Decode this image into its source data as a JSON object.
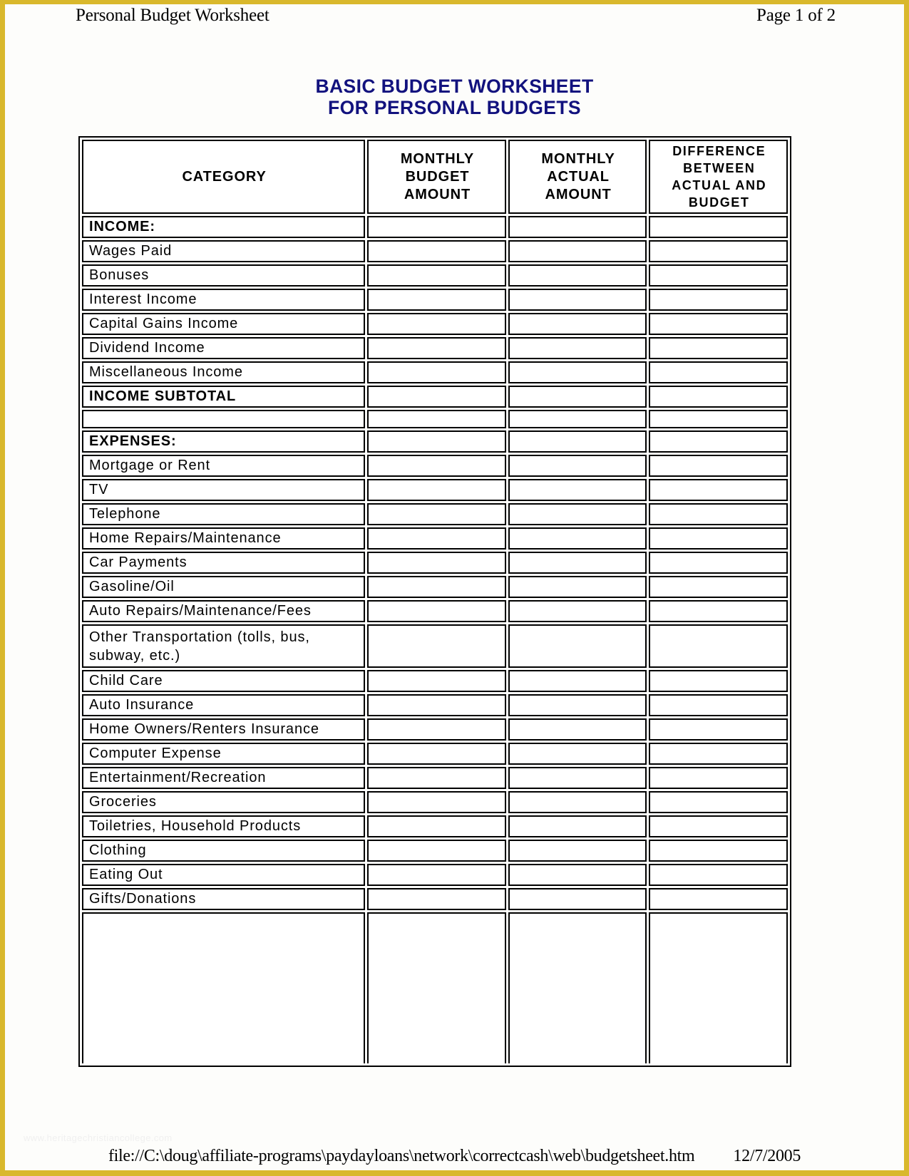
{
  "page": {
    "running_header_left": "Personal Budget Worksheet",
    "running_header_right": "Page 1 of 2",
    "title_line1": "BASIC BUDGET WORKSHEET",
    "title_line2": "FOR PERSONAL BUDGETS",
    "watermark": "www.heritagechristiancollege.com",
    "footer_path": "file://C:\\doug\\affiliate-programs\\paydayloans\\network\\correctcash\\web\\budgetsheet.htm",
    "footer_date": "12/7/2005",
    "border_color": "#d9b82c",
    "accent_color": "#12127e"
  },
  "table": {
    "columns": [
      {
        "key": "category",
        "label": "CATEGORY"
      },
      {
        "key": "monthly_budget",
        "label": "MONTHLY BUDGET AMOUNT"
      },
      {
        "key": "monthly_actual",
        "label": "MONTHLY ACTUAL AMOUNT"
      },
      {
        "key": "difference",
        "label": "DIFFERENCE BETWEEN ACTUAL AND BUDGET"
      }
    ],
    "column_label_lines": {
      "category": [
        "CATEGORY"
      ],
      "monthly_budget": [
        "MONTHLY",
        "BUDGET",
        "AMOUNT"
      ],
      "monthly_actual": [
        "MONTHLY",
        "ACTUAL",
        "AMOUNT"
      ],
      "difference": [
        "DIFFERENCE",
        "BETWEEN",
        "ACTUAL AND",
        "BUDGET"
      ]
    },
    "rows": [
      {
        "label": "INCOME:",
        "type": "section",
        "budget": "",
        "actual": "",
        "difference": ""
      },
      {
        "label": "Wages Paid",
        "type": "item",
        "budget": "",
        "actual": "",
        "difference": ""
      },
      {
        "label": "Bonuses",
        "type": "item",
        "budget": "",
        "actual": "",
        "difference": ""
      },
      {
        "label": "Interest Income",
        "type": "item",
        "budget": "",
        "actual": "",
        "difference": ""
      },
      {
        "label": "Capital Gains Income",
        "type": "item",
        "budget": "",
        "actual": "",
        "difference": ""
      },
      {
        "label": "Dividend Income",
        "type": "item",
        "budget": "",
        "actual": "",
        "difference": ""
      },
      {
        "label": "Miscellaneous Income",
        "type": "item",
        "budget": "",
        "actual": "",
        "difference": ""
      },
      {
        "label": "INCOME SUBTOTAL",
        "type": "section",
        "budget": "",
        "actual": "",
        "difference": ""
      },
      {
        "label": "",
        "type": "spacer",
        "budget": "",
        "actual": "",
        "difference": ""
      },
      {
        "label": "EXPENSES:",
        "type": "section",
        "budget": "",
        "actual": "",
        "difference": ""
      },
      {
        "label": "Mortgage or Rent",
        "type": "item",
        "budget": "",
        "actual": "",
        "difference": ""
      },
      {
        "label": "TV",
        "type": "item",
        "budget": "",
        "actual": "",
        "difference": ""
      },
      {
        "label": "Telephone",
        "type": "item",
        "budget": "",
        "actual": "",
        "difference": ""
      },
      {
        "label": "Home Repairs/Maintenance",
        "type": "item",
        "budget": "",
        "actual": "",
        "difference": ""
      },
      {
        "label": "Car Payments",
        "type": "item",
        "budget": "",
        "actual": "",
        "difference": ""
      },
      {
        "label": "Gasoline/Oil",
        "type": "item",
        "budget": "",
        "actual": "",
        "difference": ""
      },
      {
        "label": "Auto Repairs/Maintenance/Fees",
        "type": "item",
        "budget": "",
        "actual": "",
        "difference": ""
      },
      {
        "label": "Other Transportation (tolls, bus, subway, etc.)",
        "type": "tall",
        "budget": "",
        "actual": "",
        "difference": ""
      },
      {
        "label": "Child Care",
        "type": "item",
        "budget": "",
        "actual": "",
        "difference": ""
      },
      {
        "label": "Auto Insurance",
        "type": "item",
        "budget": "",
        "actual": "",
        "difference": ""
      },
      {
        "label": "Home Owners/Renters Insurance",
        "type": "item",
        "budget": "",
        "actual": "",
        "difference": ""
      },
      {
        "label": "Computer Expense",
        "type": "item",
        "budget": "",
        "actual": "",
        "difference": ""
      },
      {
        "label": "Entertainment/Recreation",
        "type": "item",
        "budget": "",
        "actual": "",
        "difference": ""
      },
      {
        "label": "Groceries",
        "type": "item",
        "budget": "",
        "actual": "",
        "difference": ""
      },
      {
        "label": "Toiletries, Household Products",
        "type": "item",
        "budget": "",
        "actual": "",
        "difference": ""
      },
      {
        "label": "Clothing",
        "type": "item",
        "budget": "",
        "actual": "",
        "difference": ""
      },
      {
        "label": "Eating Out",
        "type": "item",
        "budget": "",
        "actual": "",
        "difference": ""
      },
      {
        "label": "Gifts/Donations",
        "type": "item",
        "budget": "",
        "actual": "",
        "difference": ""
      },
      {
        "label": "",
        "type": "fill",
        "budget": "",
        "actual": "",
        "difference": ""
      }
    ]
  }
}
